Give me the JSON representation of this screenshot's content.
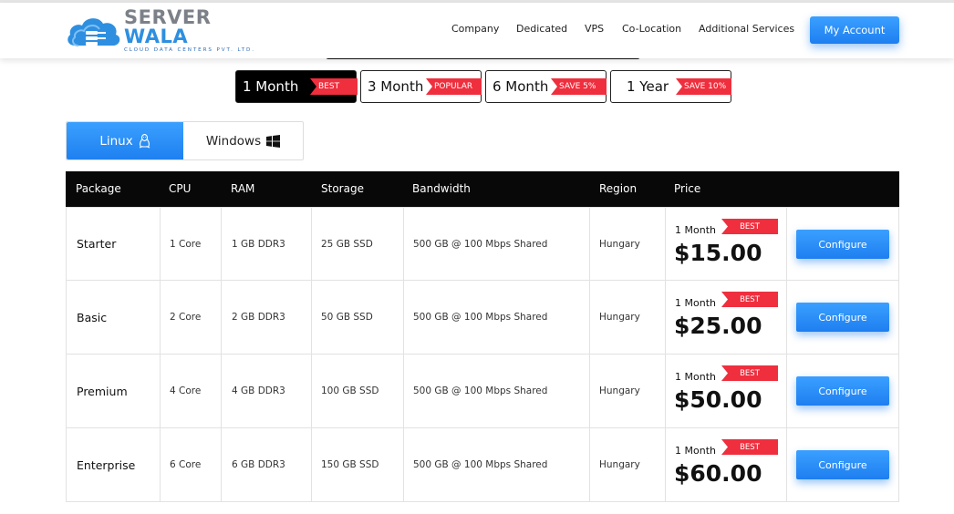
{
  "brand": {
    "logo_word1": "SERVER",
    "logo_word2": "WALA",
    "logo_sub": "CLOUD DATA CENTERS PVT. LTD.",
    "primary_color": "#1e7ef0",
    "badge_color": "#ef2f3e"
  },
  "nav": {
    "items": [
      {
        "label": "Company"
      },
      {
        "label": "Dedicated"
      },
      {
        "label": "VPS"
      },
      {
        "label": "Co-Location"
      },
      {
        "label": "Additional Services"
      }
    ],
    "account_label": "My Account"
  },
  "periods": [
    {
      "label": "1 Month",
      "badge": "BEST",
      "active": true
    },
    {
      "label": "3 Month",
      "badge": "POPULAR",
      "active": false
    },
    {
      "label": "6 Month",
      "badge": "SAVE 5%",
      "active": false
    },
    {
      "label": "1 Year",
      "badge": "SAVE 10%",
      "active": false
    }
  ],
  "os_tabs": {
    "linux": {
      "label": "Linux",
      "icon": "linux-penguin-icon",
      "active": true
    },
    "windows": {
      "label": "Windows",
      "icon": "windows-logo-icon",
      "active": false
    }
  },
  "table": {
    "headers": [
      "Package",
      "CPU",
      "RAM",
      "Storage",
      "Bandwidth",
      "Region",
      "Price"
    ],
    "rows": [
      {
        "package": "Starter",
        "cpu": "1 Core",
        "ram": "1 GB DDR3",
        "storage": "25 GB SSD",
        "bandwidth": "500 GB @ 100 Mbps Shared",
        "region": "Hungary",
        "period": "1 Month",
        "badge": "BEST",
        "price": "$15.00",
        "action": "Configure"
      },
      {
        "package": "Basic",
        "cpu": "2 Core",
        "ram": "2 GB DDR3",
        "storage": "50 GB SSD",
        "bandwidth": "500 GB @ 100 Mbps Shared",
        "region": "Hungary",
        "period": "1 Month",
        "badge": "BEST",
        "price": "$25.00",
        "action": "Configure"
      },
      {
        "package": "Premium",
        "cpu": "4 Core",
        "ram": "4 GB DDR3",
        "storage": "100 GB SSD",
        "bandwidth": "500 GB @ 100 Mbps Shared",
        "region": "Hungary",
        "period": "1 Month",
        "badge": "BEST",
        "price": "$50.00",
        "action": "Configure"
      },
      {
        "package": "Enterprise",
        "cpu": "6 Core",
        "ram": "6 GB DDR3",
        "storage": "150 GB SSD",
        "bandwidth": "500 GB @ 100 Mbps Shared",
        "region": "Hungary",
        "period": "1 Month",
        "badge": "BEST",
        "price": "$60.00",
        "action": "Configure"
      }
    ]
  }
}
